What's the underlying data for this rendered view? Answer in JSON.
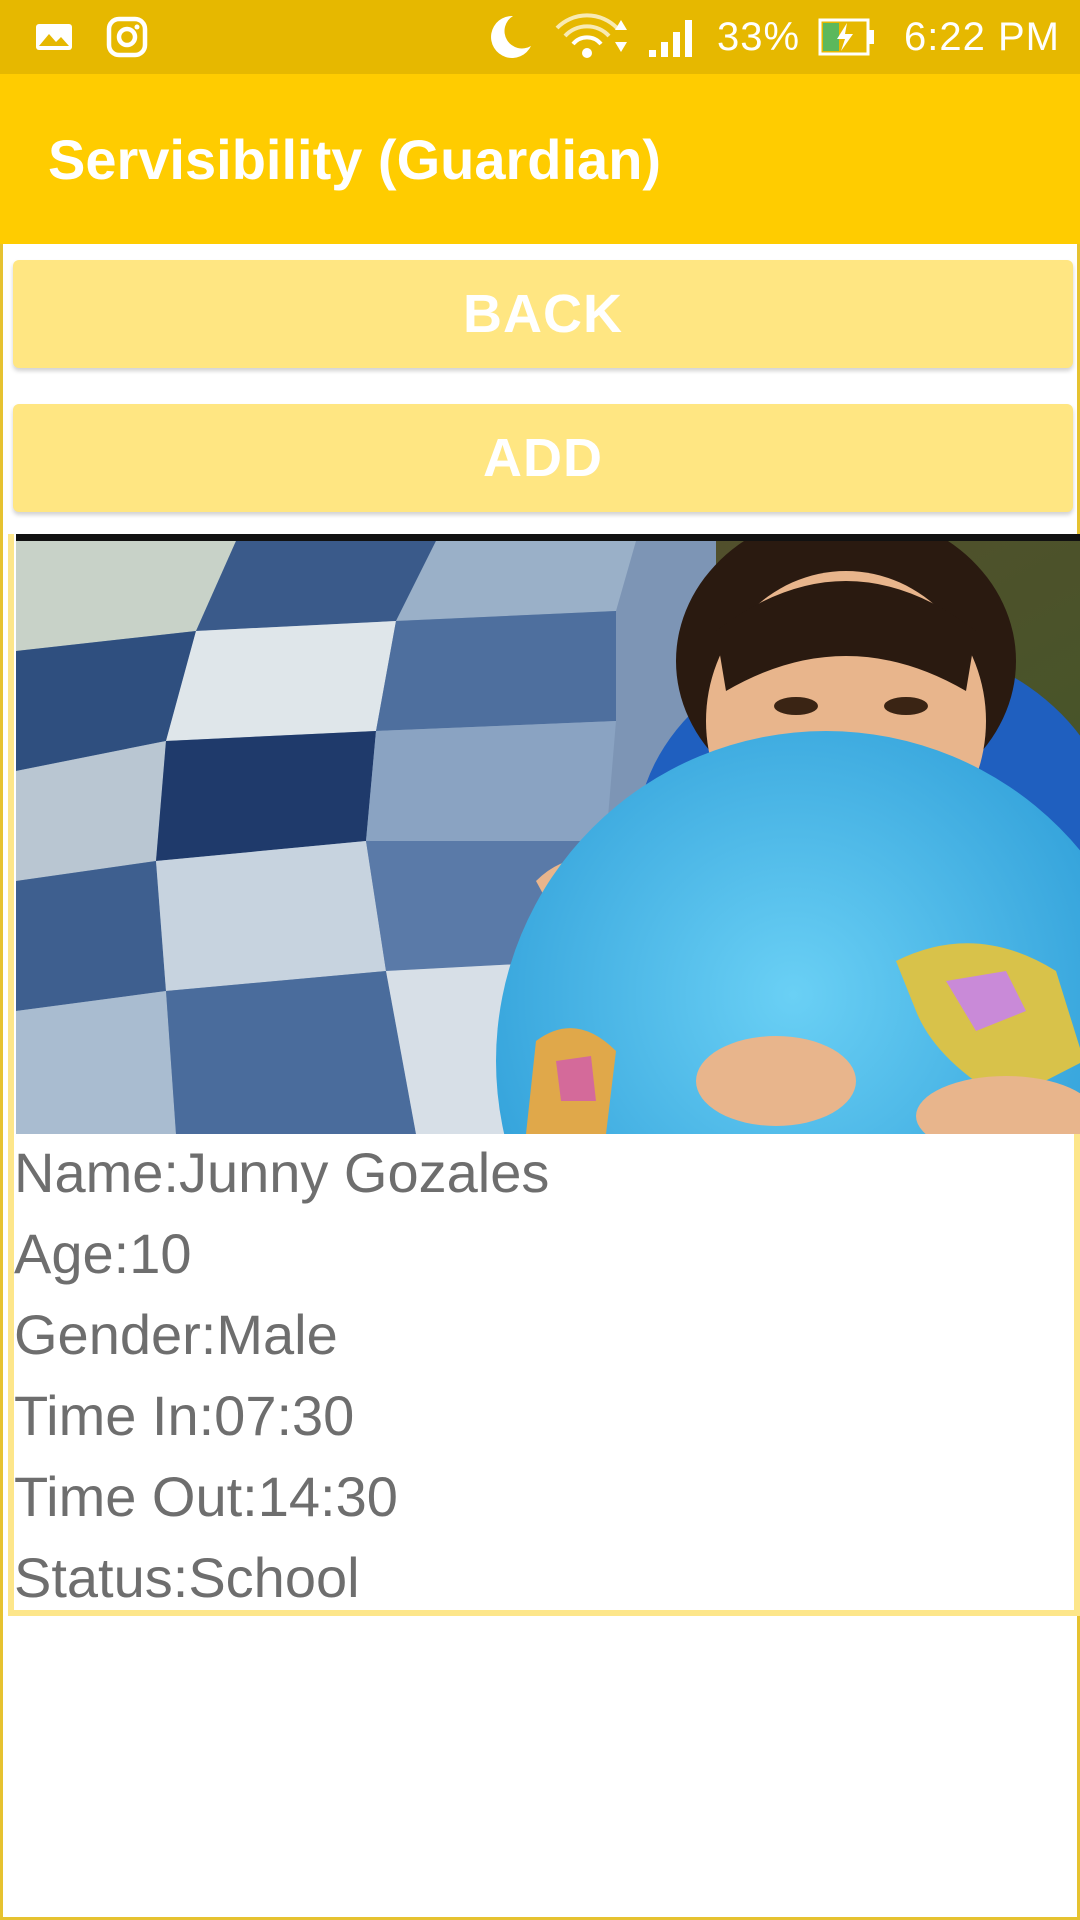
{
  "status_bar": {
    "left_icons": [
      "gallery-icon",
      "instagram-icon"
    ],
    "right_icons": [
      "moon-icon",
      "wifi-icon",
      "signal-icon",
      "battery-charging-icon"
    ],
    "battery": "33%",
    "time": "6:22 PM",
    "color": "#e6b800"
  },
  "app_bar": {
    "title": "Servisibility (Guardian)",
    "color": "#ffcc00"
  },
  "buttons": {
    "back_label": "BACK",
    "add_label": "ADD",
    "color": "#ffe682"
  },
  "child": {
    "name_label": "Name:Junny Gozales",
    "age_label": "Age:10",
    "gender_label": "Gender:Male",
    "time_in_label": "Time In:07:30",
    "time_out_label": "Time Out:14:30",
    "status_label": "Status:School"
  }
}
